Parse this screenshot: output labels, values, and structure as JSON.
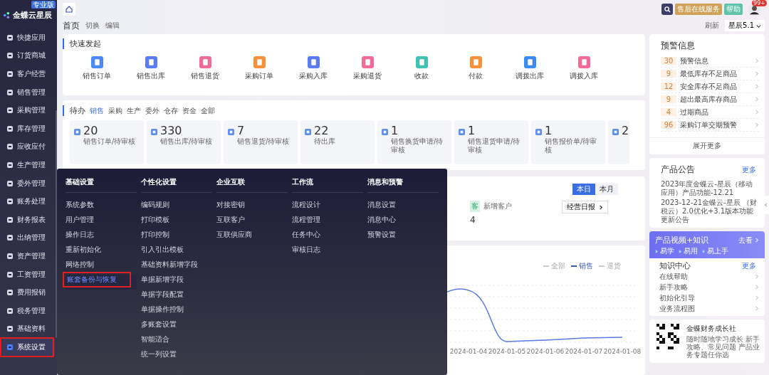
{
  "sidebar": {
    "logo": "金蝶云星辰",
    "edition": "专业版",
    "items": [
      {
        "label": "快捷应用",
        "selected": false,
        "highlighted": false
      },
      {
        "label": "订货商城",
        "selected": false,
        "highlighted": false
      },
      {
        "label": "客户经营",
        "selected": false,
        "highlighted": false
      },
      {
        "label": "销售管理",
        "selected": false,
        "highlighted": false
      },
      {
        "label": "采购管理",
        "selected": false,
        "highlighted": false
      },
      {
        "label": "库存管理",
        "selected": false,
        "highlighted": false
      },
      {
        "label": "应收应付",
        "selected": false,
        "highlighted": false
      },
      {
        "label": "生产管理",
        "selected": false,
        "highlighted": false
      },
      {
        "label": "委外管理",
        "selected": false,
        "highlighted": false
      },
      {
        "label": "账务处理",
        "selected": false,
        "highlighted": false
      },
      {
        "label": "财务报表",
        "selected": false,
        "highlighted": false
      },
      {
        "label": "出纳管理",
        "selected": false,
        "highlighted": false
      },
      {
        "label": "资产管理",
        "selected": false,
        "highlighted": false
      },
      {
        "label": "工资管理",
        "selected": false,
        "highlighted": false
      },
      {
        "label": "费用报销",
        "selected": false,
        "highlighted": false
      },
      {
        "label": "税务管理",
        "selected": false,
        "highlighted": false
      },
      {
        "label": "基础资料",
        "selected": false,
        "highlighted": false
      },
      {
        "label": "系统设置",
        "selected": true,
        "highlighted": true
      }
    ]
  },
  "header": {
    "page": "首页",
    "switch": "切换",
    "edit": "编辑",
    "service": "售后",
    "service_sub": "在线服务",
    "help": "帮助",
    "badge": "99+",
    "refresh": "刷新",
    "version": "星辰5.1"
  },
  "quick": {
    "title": "快速发起",
    "items": [
      {
        "label": "销售订单",
        "color": "#4a8af4"
      },
      {
        "label": "销售出库",
        "color": "#5b7cf0"
      },
      {
        "label": "销售退货",
        "color": "#f06a9a"
      },
      {
        "label": "采购订单",
        "color": "#f4913a"
      },
      {
        "label": "采购入库",
        "color": "#5b7cf0"
      },
      {
        "label": "采购退货",
        "color": "#f06a9a"
      },
      {
        "label": "收款",
        "color": "#3fc2b0"
      },
      {
        "label": "付款",
        "color": "#f4913a"
      },
      {
        "label": "调拨出库",
        "color": "#3a8cf0"
      },
      {
        "label": "调拨入库",
        "color": "#f06a9a"
      }
    ]
  },
  "todo": {
    "title": "待办",
    "tabs": [
      {
        "label": "销售",
        "selected": true
      },
      {
        "label": "采购",
        "selected": false
      },
      {
        "label": "生产",
        "selected": false
      },
      {
        "label": "委外",
        "selected": false
      },
      {
        "label": "仓存",
        "selected": false
      },
      {
        "label": "资金",
        "selected": false
      },
      {
        "label": "全部",
        "selected": false
      }
    ],
    "cards": [
      {
        "count": "20",
        "label": "销售订单/待审核"
      },
      {
        "count": "330",
        "label": "销售出库/待审核"
      },
      {
        "count": "7",
        "label": "销售退货/待审核"
      },
      {
        "count": "22",
        "label": "待出库"
      },
      {
        "count": "1",
        "label": "销售换货申请/待审核"
      },
      {
        "count": "1",
        "label": "销售退货申请/待审核"
      },
      {
        "count": "1",
        "label": "销售报价单/待审核"
      },
      {
        "count": "2"
      }
    ]
  },
  "daily": {
    "periods": [
      {
        "label": "本日",
        "selected": true
      },
      {
        "label": "本月",
        "selected": false
      }
    ],
    "customer_badge": "客",
    "customer_label": "新增客户",
    "customer_value": "4",
    "report": "经营日报"
  },
  "trend": {
    "legend": [
      {
        "label": "全部",
        "on": false
      },
      {
        "label": "销售",
        "on": true
      },
      {
        "label": "退货",
        "on": false
      }
    ],
    "dates": [
      "2024-01-04",
      "2024-01-05",
      "2024-01-06",
      "2024-01-07",
      "2024-01-08"
    ]
  },
  "menu": {
    "columns": [
      {
        "title": "基础设置",
        "items": [
          {
            "label": "系统参数",
            "selected": false
          },
          {
            "label": "用户管理",
            "selected": false
          },
          {
            "label": "操作日志",
            "selected": false
          },
          {
            "label": "重新初始化",
            "selected": false
          },
          {
            "label": "网络控制",
            "selected": false
          },
          {
            "label": "账套备份与恢复",
            "selected": true
          }
        ]
      },
      {
        "title": "个性化设置",
        "items": [
          {
            "label": "编码规则",
            "selected": false
          },
          {
            "label": "打印模板",
            "selected": false
          },
          {
            "label": "打印控制",
            "selected": false
          },
          {
            "label": "引入引出模板",
            "selected": false
          },
          {
            "label": "基础资料新增字段",
            "selected": false
          },
          {
            "label": "单据新增字段",
            "selected": false
          },
          {
            "label": "单据字段配置",
            "selected": false
          },
          {
            "label": "单据操作控制",
            "selected": false
          },
          {
            "label": "多账套设置",
            "selected": false
          },
          {
            "label": "智能适合",
            "selected": false
          },
          {
            "label": "统一列设置",
            "selected": false
          }
        ]
      },
      {
        "title": "企业互联",
        "items": [
          {
            "label": "对接密钥",
            "selected": false
          },
          {
            "label": "互联客户",
            "selected": false
          },
          {
            "label": "互联供应商",
            "selected": false
          }
        ]
      },
      {
        "title": "工作流",
        "items": [
          {
            "label": "流程设计",
            "selected": false
          },
          {
            "label": "流程管理",
            "selected": false
          },
          {
            "label": "任务中心",
            "selected": false
          },
          {
            "label": "审核日志",
            "selected": false
          }
        ]
      },
      {
        "title": "消息和预警",
        "items": [
          {
            "label": "消息设置",
            "selected": false
          },
          {
            "label": "消息中心",
            "selected": false
          },
          {
            "label": "预警设置",
            "selected": false
          }
        ]
      }
    ]
  },
  "alerts": {
    "title": "预警信息",
    "items": [
      {
        "count": "30",
        "label": "预警信息"
      },
      {
        "count": "9",
        "label": "最低库存不足商品"
      },
      {
        "count": "12",
        "label": "安全库存不足商品"
      },
      {
        "count": "9",
        "label": "超出最高库存商品"
      },
      {
        "count": "4",
        "label": "过期商品"
      },
      {
        "count": "96",
        "label": "采购订单交期预警"
      }
    ],
    "more": "展开更多"
  },
  "notices": {
    "title": "产品公告",
    "more": "更多",
    "items": [
      "2023年度金蝶云-星辰（移动应用）产品功能-12.21",
      "2023-12-21金蝶云-星辰 （财税云）2.0优化+3.1版本功能更新公告"
    ]
  },
  "banner": {
    "title": "产品视频+知识",
    "go": "去看",
    "tags": [
      "易学",
      "易用",
      "易上手"
    ]
  },
  "knowledge": {
    "title": "知识中心",
    "more": "更多",
    "items": [
      "在线帮助",
      "新手攻略",
      "初始化引导",
      "业务流程图"
    ]
  },
  "community": {
    "title": "金蝶财务成长社",
    "text": "随时随地学习成长 新手攻略、常见问题 产品业务专题任你选"
  }
}
